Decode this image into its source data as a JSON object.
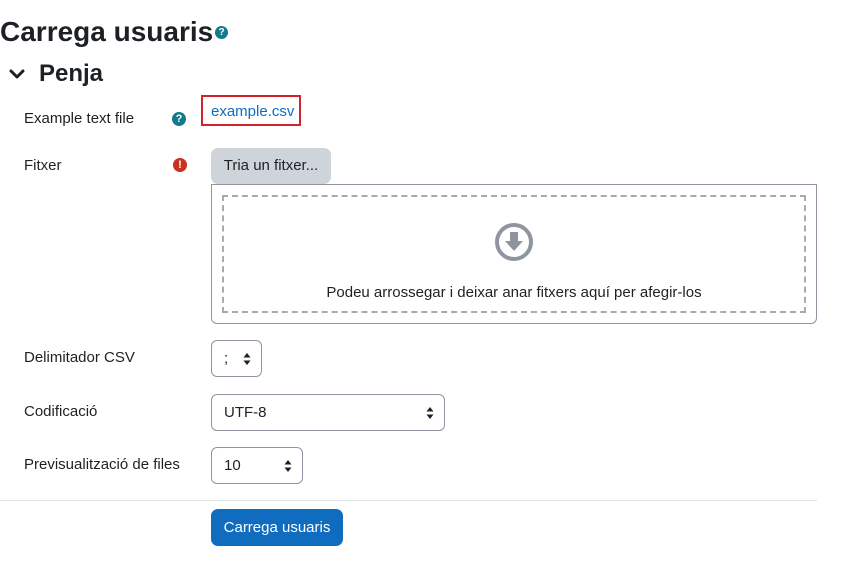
{
  "page": {
    "title": "Carrega usuaris",
    "section_title": "Penja"
  },
  "form": {
    "example_label": "Example text file",
    "example_link": "example.csv",
    "file_label": "Fitxer",
    "file_button": "Tria un fitxer...",
    "dropzone_text": "Podeu arrossegar i deixar anar fitxers aquí per afegir-los",
    "delimiter_label": "Delimitador CSV",
    "delimiter_value": ";",
    "encoding_label": "Codificació",
    "encoding_value": "UTF-8",
    "preview_label": "Previsualització de files",
    "preview_value": "10",
    "submit_label": "Carrega usuaris"
  },
  "icons": {
    "help": "question-circle-icon",
    "required": "exclamation-circle-icon",
    "collapse": "chevron-down-icon",
    "drop": "arrow-circle-down-icon"
  },
  "colors": {
    "primary": "#0f6cbf",
    "help": "#117a8b",
    "required": "#ca3120",
    "highlight": "#d3222a"
  }
}
